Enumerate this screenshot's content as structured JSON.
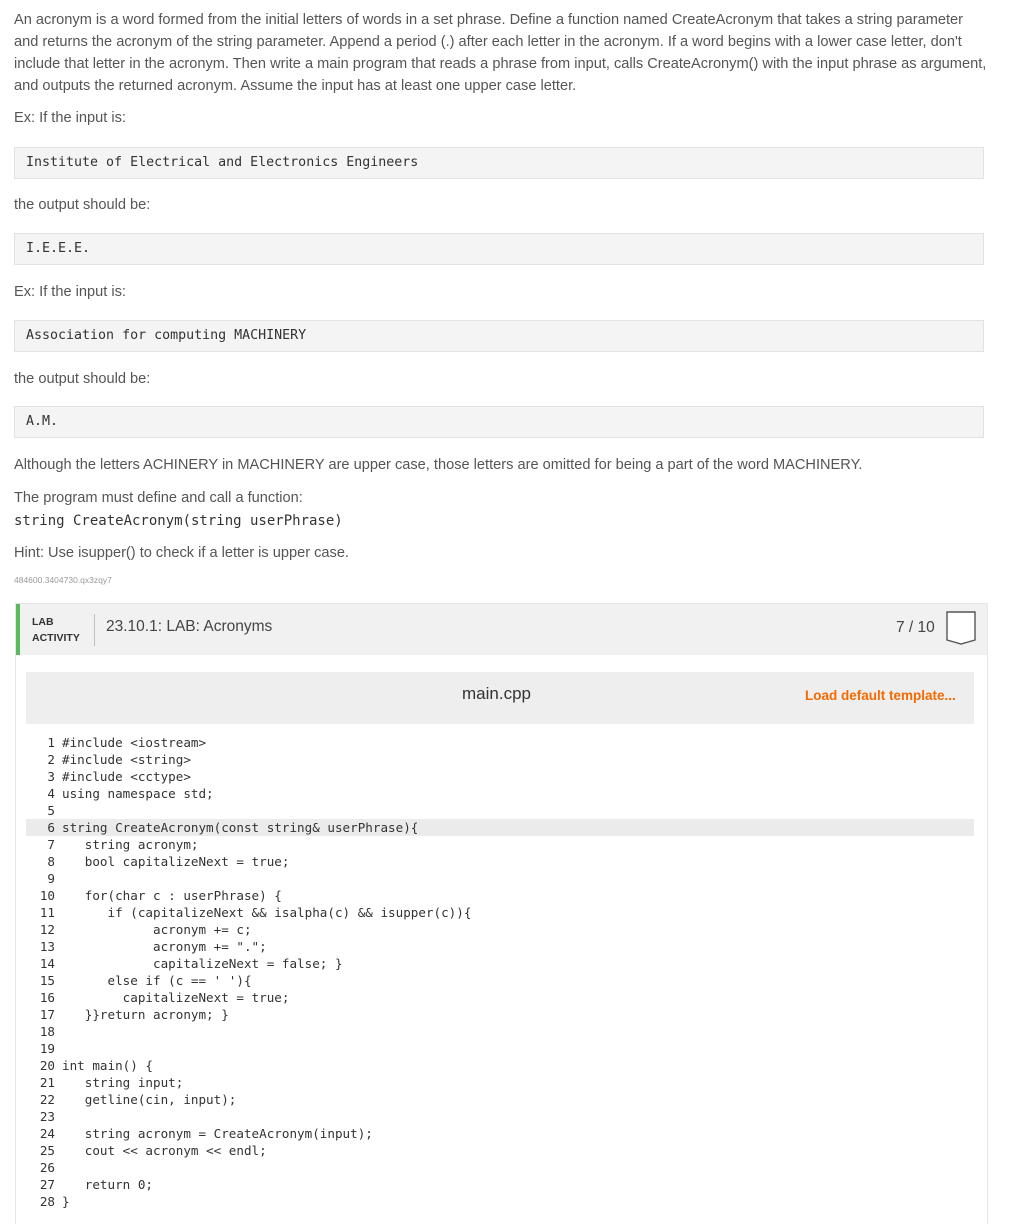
{
  "problem": {
    "intro": "An acronym is a word formed from the initial letters of words in a set phrase. Define a function named CreateAcronym that takes a string parameter and returns the acronym of the string parameter. Append a period (.) after each letter in the acronym. If a word begins with a lower case letter, don't include that letter in the acronym. Then write a main program that reads a phrase from input, calls CreateAcronym() with the input phrase as argument, and outputs the returned acronym. Assume the input has at least one upper case letter.",
    "ex1_label": "Ex: If the input is:",
    "ex1_input": "Institute of Electrical and Electronics Engineers",
    "ex1_output_label": "the output should be:",
    "ex1_output": "I.E.E.E.",
    "ex2_label": "Ex: If the input is:",
    "ex2_input": "Association for computing MACHINERY",
    "ex2_output_label": "the output should be:",
    "ex2_output": "A.M.",
    "note": "Although the letters ACHINERY in MACHINERY are upper case, those letters are omitted for being a part of the word MACHINERY.",
    "define_text": "The program must define and call a function:",
    "signature": "string CreateAcronym(string userPhrase)",
    "hint": "Hint: Use isupper() to check if a letter is upper case.",
    "tracking_id": "484600.3404730.qx3zqy7"
  },
  "lab": {
    "tag_line1": "LAB",
    "tag_line2": "ACTIVITY",
    "title": "23.10.1: LAB: Acronyms",
    "score": "7 / 10",
    "filename": "main.cpp",
    "load_template": "Load default template...",
    "active_line": 6,
    "code_lines": [
      "#include <iostream>",
      "#include <string>",
      "#include <cctype>",
      "using namespace std;",
      "",
      "string CreateAcronym(const string& userPhrase){",
      "   string acronym;",
      "   bool capitalizeNext = true;",
      "",
      "   for(char c : userPhrase) {",
      "      if (capitalizeNext && isalpha(c) && isupper(c)){",
      "            acronym += c;",
      "            acronym += \".\";",
      "            capitalizeNext = false; }",
      "      else if (c == ' '){",
      "        capitalizeNext = true;",
      "   }}return acronym; }",
      "",
      "",
      "int main() {",
      "   string input;",
      "   getline(cin, input);",
      "",
      "   string acronym = CreateAcronym(input);",
      "   cout << acronym << endl;",
      "",
      "   return 0;",
      "}"
    ]
  },
  "colors": {
    "accent_green": "#5cb85c",
    "link_orange": "#f46a00"
  }
}
